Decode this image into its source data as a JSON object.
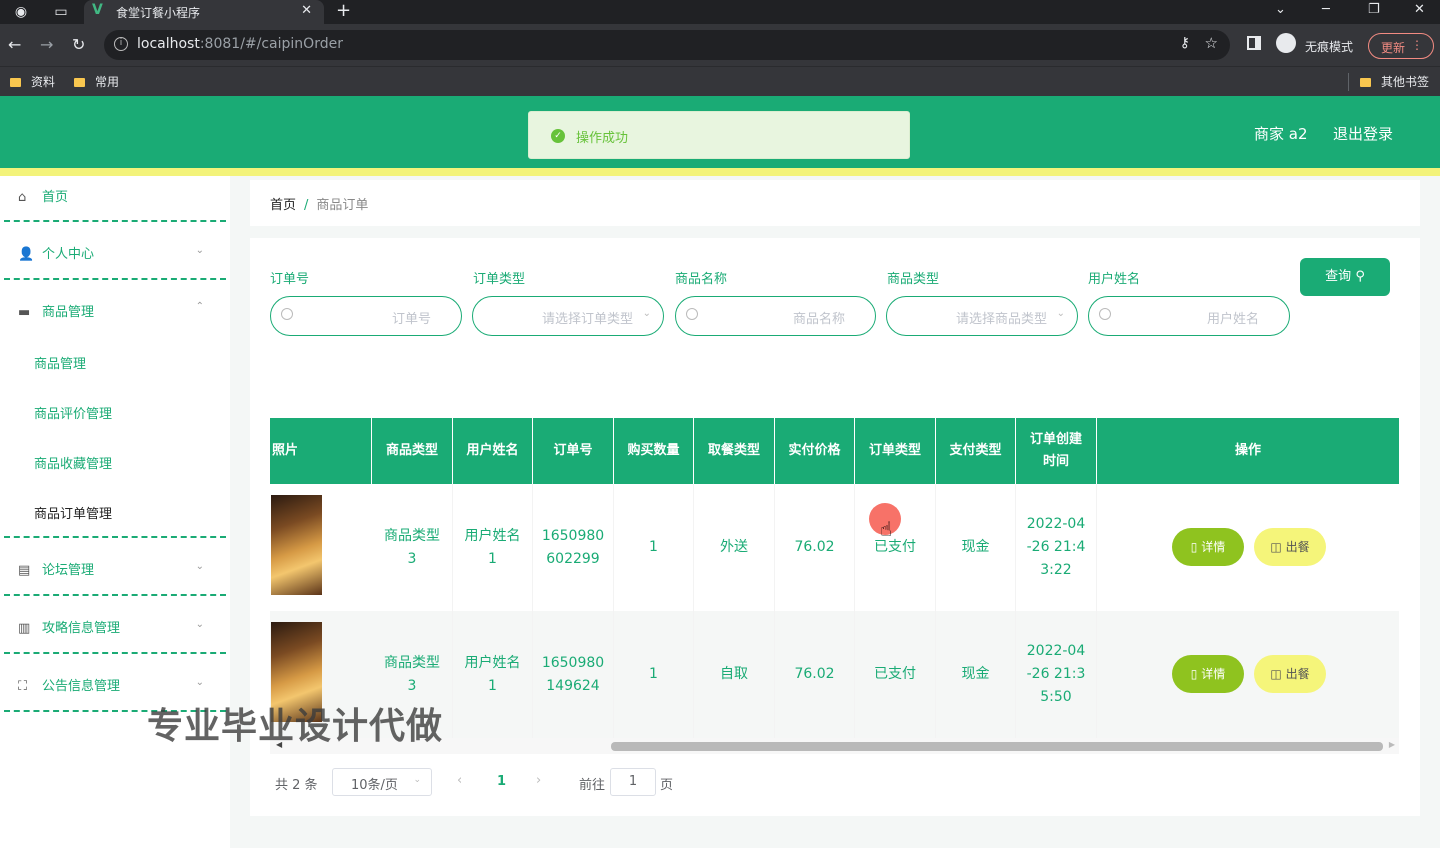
{
  "browser": {
    "tab_title": "食堂订餐小程序",
    "url_host": "localhost",
    "url_path": ":8081/#/caipinOrder",
    "incognito_label": "无痕模式",
    "update_label": "更新",
    "bookmarks": [
      "资料",
      "常用"
    ],
    "other_bookmarks": "其他书签"
  },
  "header": {
    "toast": "操作成功",
    "user": "商家 a2",
    "logout": "退出登录"
  },
  "sidebar": {
    "items": [
      {
        "label": "首页",
        "icon": "home-icon"
      },
      {
        "label": "个人中心",
        "icon": "user-icon"
      },
      {
        "label": "商品管理",
        "icon": "briefcase-icon"
      },
      {
        "label": "论坛管理",
        "icon": "forum-icon"
      },
      {
        "label": "攻略信息管理",
        "icon": "clipboard-icon"
      },
      {
        "label": "公告信息管理",
        "icon": "frame-icon"
      }
    ],
    "submenu": [
      "商品管理",
      "商品评价管理",
      "商品收藏管理",
      "商品订单管理"
    ]
  },
  "watermark": "专业毕业设计代做",
  "breadcrumb": {
    "home": "首页",
    "sep": "/",
    "current": "商品订单"
  },
  "filters": [
    {
      "label": "订单号",
      "placeholder": "订单号",
      "type": "search"
    },
    {
      "label": "订单类型",
      "placeholder": "请选择订单类型",
      "type": "select"
    },
    {
      "label": "商品名称",
      "placeholder": "商品名称",
      "type": "search"
    },
    {
      "label": "商品类型",
      "placeholder": "请选择商品类型",
      "type": "select"
    },
    {
      "label": "用户姓名",
      "placeholder": "用户姓名",
      "type": "search"
    }
  ],
  "query_label": "查询",
  "table": {
    "columns": [
      "照片",
      "商品类型",
      "用户姓名",
      "订单号",
      "购买数量",
      "取餐类型",
      "实付价格",
      "订单类型",
      "支付类型",
      "订单创建时间",
      "操作"
    ],
    "rows": [
      {
        "type": "商品类型3",
        "user": "用户姓名1",
        "order_no": "1650980602299",
        "qty": "1",
        "pickup": "外送",
        "price": "76.02",
        "order_type": "已支付",
        "pay": "现金",
        "time": "2022-04-26 21:43:22"
      },
      {
        "type": "商品类型3",
        "user": "用户姓名1",
        "order_no": "1650980149624",
        "qty": "1",
        "pickup": "自取",
        "price": "76.02",
        "order_type": "已支付",
        "pay": "现金",
        "time": "2022-04-26 21:35:50"
      }
    ],
    "detail_label": "详情",
    "out_label": "出餐"
  },
  "pagination": {
    "total": "共 2 条",
    "page_size": "10条/页",
    "current_page": "1",
    "goto_label": "前往",
    "goto_value": "1",
    "page_unit": "页"
  }
}
